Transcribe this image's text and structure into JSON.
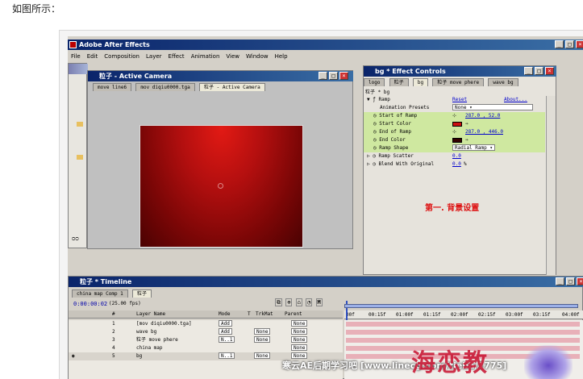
{
  "caption": "如图所示：",
  "app": {
    "title": "Adobe After Effects",
    "menu": [
      "File",
      "Edit",
      "Composition",
      "Layer",
      "Effect",
      "Animation",
      "View",
      "Window",
      "Help"
    ]
  },
  "comp_window": {
    "title": "粒子 - Active Camera",
    "tabs": [
      "move line6",
      "mov diqiu0000.tga",
      "粒子 - Active Camera"
    ]
  },
  "effect_controls": {
    "title": "bg * Effect Controls",
    "tabs": [
      "logo",
      "粒子",
      "bg",
      "粒子 move phere",
      "wave bg"
    ],
    "breadcrumb": "粒子 * bg",
    "effect_name": "Ramp",
    "reset": "Reset",
    "about": "About...",
    "presets_label": "Animation Presets",
    "presets_value": "None",
    "start_label": "Start of Ramp",
    "start_value": "287.0 , 52.0",
    "start_color_label": "Start Color",
    "end_label": "End of Ramp",
    "end_value": "287.0 , 446.0",
    "end_color_label": "End Color",
    "shape_label": "Ramp Shape",
    "shape_value": "Radial Ramp",
    "scatter_label": "Ramp Scatter",
    "scatter_value": "0.0",
    "blend_label": "Blend With Original",
    "blend_value": "0.0",
    "blend_unit": "%",
    "note": "第一. 背景设置",
    "start_color": "#cc1111",
    "end_color": "#330000"
  },
  "timeline": {
    "title": "粒子 * Timeline",
    "tabs": [
      "china map Comp 1",
      "粒子"
    ],
    "time": "0:00:00:02",
    "fps": "(25.00 fps)",
    "col_num": "#",
    "col_name": "Layer Name",
    "col_mode": "Mode",
    "col_t": "T",
    "col_trkmat": "TrkMat",
    "col_parent": "Parent",
    "ruler": [
      "00f",
      "00:15f",
      "01:00f",
      "01:15f",
      "02:00f",
      "02:15f",
      "03:00f",
      "03:15f",
      "04:00f"
    ],
    "layers": [
      {
        "num": "1",
        "name": "[mov diqiu0000.tga]",
        "mode": "Add",
        "trk": "",
        "parent": "None"
      },
      {
        "num": "2",
        "name": "wave bg",
        "mode": "Add",
        "trk": "None",
        "parent": "None"
      },
      {
        "num": "3",
        "name": "粒子 move phere",
        "mode": "N..1",
        "trk": "None",
        "parent": "None"
      },
      {
        "num": "4",
        "name": "china map",
        "mode": "",
        "trk": "",
        "parent": "None"
      },
      {
        "num": "5",
        "name": "bg",
        "mode": "N..1",
        "trk": "None",
        "parent": "None"
      }
    ]
  },
  "watermark": {
    "site": "寒云AE后期学习吧 [www.linecg.com/tieba/1775]",
    "logo": "海恋教"
  }
}
